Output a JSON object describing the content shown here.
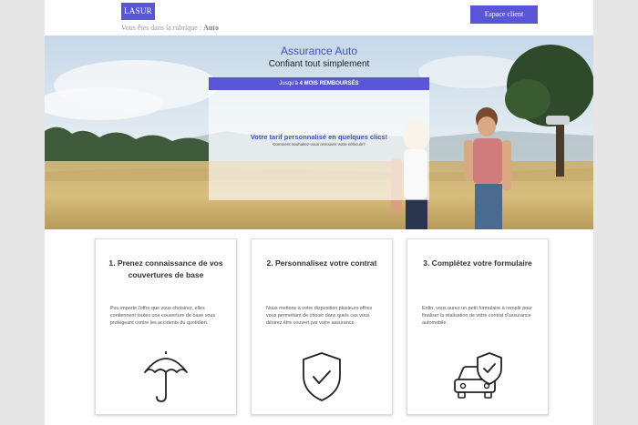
{
  "header": {
    "logo": "LASUR",
    "breadcrumb_prefix": "Vous êtes dans la rubrique : ",
    "breadcrumb_section": "Auto",
    "client_button": "Espace client"
  },
  "hero": {
    "title": "Assurance Auto",
    "subtitle": "Confiant tout simplement",
    "promo_prefix": "Jusqu'à ",
    "promo_bold": "4 MOIS REMBOURSÉS",
    "quote_title": "Votre tarif personnalisé en quelques clics!",
    "quote_question": "Comment souhaitez-vous retrouver votre véhicule?"
  },
  "steps": [
    {
      "title": "1. Prenez connaissance de vos couvertures de base",
      "text": "Peu importe l'offre que vous choisirez, elles contiennent toutes une couverture de base vous protégeant contre les accidents du quotidien.",
      "icon": "umbrella-icon"
    },
    {
      "title": "2. Personnalisez votre contrat",
      "text": "Nous mettons à votre disposition plusieurs offres vous permettant de choisir dans quels cas vous désirez être couvert par votre assurance.",
      "icon": "shield-check-icon"
    },
    {
      "title": "3. Complétez votre formulaire",
      "text": "Enfin, vous aurez un petit formulaire à remplir pour finaliser la réalisation de votre contrat d'assurance automobile.",
      "icon": "car-shield-icon"
    }
  ],
  "colors": {
    "accent": "#5856d6",
    "title_blue": "#3f4fbf"
  }
}
